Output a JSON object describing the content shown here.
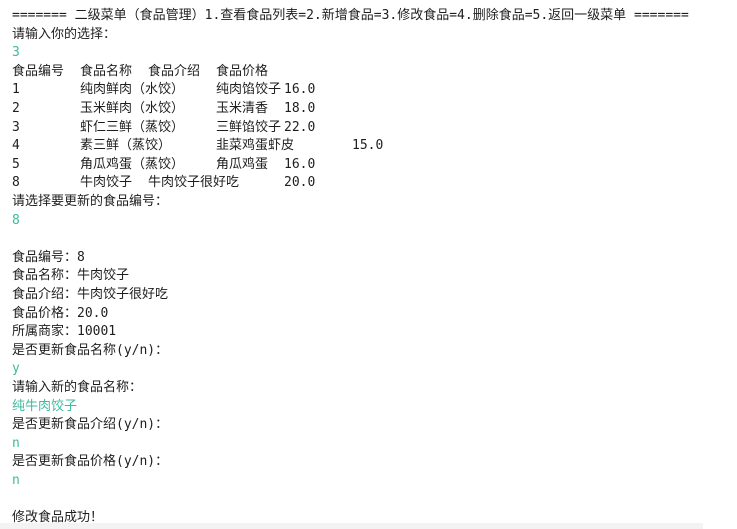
{
  "menu_header": "======= 二级菜单（食品管理）1.查看食品列表=2.新增食品=3.修改食品=4.删除食品=5.返回一级菜单 =======",
  "prompt_choice": "请输入你的选择：",
  "input_choice": "3",
  "table": {
    "headers": [
      "食品编号",
      "食品名称",
      "食品介绍",
      "食品价格"
    ],
    "rows": [
      {
        "id": "1",
        "name": "纯肉鲜肉（水饺）",
        "desc": "纯肉馅饺子",
        "price": "16.0"
      },
      {
        "id": "2",
        "name": "玉米鲜肉（水饺）",
        "desc": "玉米清香",
        "price": "18.0"
      },
      {
        "id": "3",
        "name": "虾仁三鲜（蒸饺）",
        "desc": "三鲜馅饺子",
        "price": "22.0"
      },
      {
        "id": "4",
        "name": "素三鲜（蒸饺）",
        "desc": "韭菜鸡蛋虾皮",
        "price": "15.0"
      },
      {
        "id": "5",
        "name": "角瓜鸡蛋（蒸饺）",
        "desc": "角瓜鸡蛋",
        "price": "16.0"
      },
      {
        "id": "8",
        "name": "牛肉饺子",
        "desc": "牛肉饺子很好吃",
        "price": "20.0"
      }
    ]
  },
  "prompt_select": "请选择要更新的食品编号：",
  "input_id": "8",
  "details": [
    "食品编号：8",
    "食品名称：牛肉饺子",
    "食品介绍：牛肉饺子很好吃",
    "食品价格：20.0",
    "所属商家：10001"
  ],
  "q_update_name": "是否更新食品名称(y/n)：",
  "a_update_name": "y",
  "prompt_new_name": "请输入新的食品名称：",
  "a_new_name": "纯牛肉饺子",
  "q_update_desc": "是否更新食品介绍(y/n)：",
  "a_update_desc": "n",
  "q_update_price": "是否更新食品价格(y/n)：",
  "a_update_price": "n",
  "success_msg": "修改食品成功！"
}
